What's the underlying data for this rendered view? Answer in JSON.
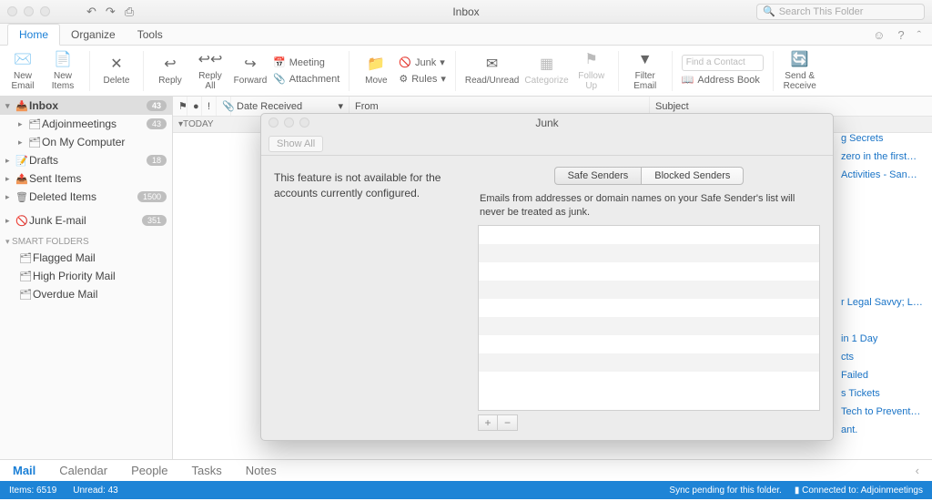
{
  "title": "Inbox",
  "search_placeholder": "Search This Folder",
  "tabs": {
    "home": "Home",
    "organize": "Organize",
    "tools": "Tools"
  },
  "ribbon": {
    "new_email": "New\nEmail",
    "new_items": "New\nItems",
    "delete": "Delete",
    "reply": "Reply",
    "reply_all": "Reply\nAll",
    "forward": "Forward",
    "meeting": "Meeting",
    "attachment": "Attachment",
    "move": "Move",
    "junk": "Junk",
    "rules": "Rules",
    "read_unread": "Read/Unread",
    "categorize": "Categorize",
    "follow_up": "Follow\nUp",
    "filter": "Filter\nEmail",
    "find_contact": "Find a Contact",
    "address_book": "Address Book",
    "send_receive": "Send &\nReceive"
  },
  "sidebar": {
    "inbox": "Inbox",
    "inbox_badge": "43",
    "adjoin": "Adjoinmeetings",
    "adjoin_badge": "43",
    "onmy": "On My Computer",
    "drafts": "Drafts",
    "drafts_badge": "18",
    "sent": "Sent Items",
    "deleted": "Deleted Items",
    "deleted_badge": "1500",
    "junk": "Junk E-mail",
    "junk_badge": "351",
    "smart_head": "SMART FOLDERS",
    "flagged": "Flagged Mail",
    "high": "High Priority Mail",
    "overdue": "Overdue Mail"
  },
  "columns": {
    "date": "Date Received",
    "from": "From",
    "subject": "Subject"
  },
  "today_label": "TODAY",
  "peek": {
    "s0": "g Secrets",
    "s1": "zero in the first…",
    "s2": "Activities - San…",
    "s3": "r Legal Savvy; L…",
    "s4": "in 1 Day",
    "s5": "cts",
    "s6": "Failed",
    "s7": "s Tickets",
    "s8": "Tech to Prevent…",
    "s9": "ant."
  },
  "nav": {
    "mail": "Mail",
    "calendar": "Calendar",
    "people": "People",
    "tasks": "Tasks",
    "notes": "Notes"
  },
  "status": {
    "items": "Items: 6519",
    "unread": "Unread: 43",
    "sync": "Sync pending for this folder.",
    "conn": "Connected to: Adjoinmeetings"
  },
  "modal": {
    "title": "Junk",
    "show_all": "Show All",
    "left_msg": "This feature is not available for the accounts currently configured.",
    "tab_safe": "Safe Senders",
    "tab_blocked": "Blocked Senders",
    "desc": "Emails from addresses or domain names on your Safe Sender's list will never be treated as junk."
  }
}
